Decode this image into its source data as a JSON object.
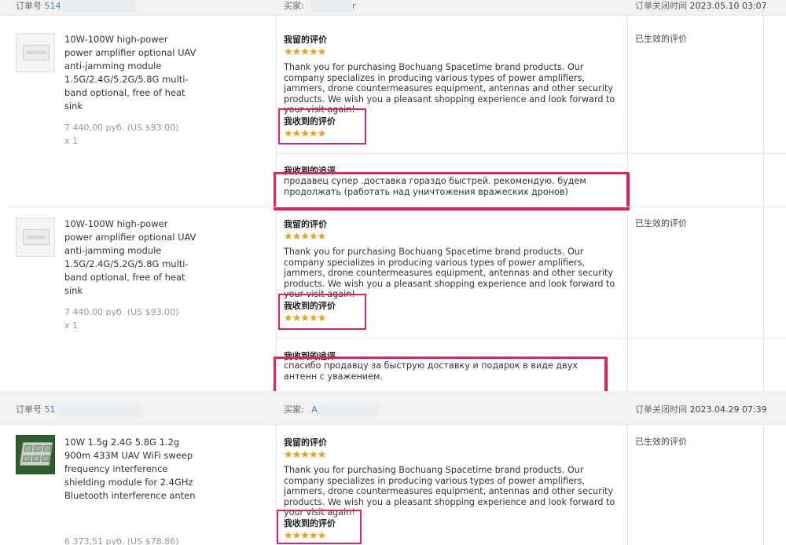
{
  "labels": {
    "order_no": "订单号",
    "buyer": "买家:",
    "close_time": "订单关闭时间",
    "my_review": "我留的评价",
    "received_review": "我收到的评价",
    "received_followup": "我收到的追评",
    "status_effective": "已生效的评价"
  },
  "rating_stars": "★★★★★",
  "orders": [
    {
      "order_no_visible": "514",
      "buyer_visible": "r",
      "close_time": "2023.05.10 03:07",
      "items": [
        {
          "name": "10W-100W high-power power amplifier optional UAV anti-jamming module 1.5G/2.4G/5.2G/5.8G multi-band optional, free of heat sink",
          "price": "7 440,00 руб. (US $93.00)",
          "qty": "x 1",
          "my_review_text": "Thank you for purchasing Bochuang Spacetime brand products. Our company specializes in producing various types of power amplifiers, jammers, drone countermeasures equipment, antennas and other security products. We wish you a pleasant shopping experience and look forward to your visit again!",
          "followup_text": "продавец супер .доставка гораздо быстрей. рекомендую. будем продолжать (работать над уничтожения вражеских дронов)"
        },
        {
          "name": "10W-100W high-power power amplifier optional UAV anti-jamming module 1.5G/2.4G/5.2G/5.8G multi-band optional, free of heat sink",
          "price": "7 440,00 руб. (US $93.00)",
          "qty": "x 1",
          "my_review_text": "Thank you for purchasing Bochuang Spacetime brand products. Our company specializes in producing various types of power amplifiers, jammers, drone countermeasures equipment, antennas and other security products. We wish you a pleasant shopping experience and look forward to your visit again!",
          "followup_text": "спасибо продавцу за быструю доставку и подарок в виде двух антенн с уважением."
        }
      ]
    },
    {
      "order_no_visible": "51",
      "buyer_visible": "A",
      "close_time": "2023.04.29 07:39",
      "items": [
        {
          "name": "10W 1.5g 2.4G 5.8G 1.2g 900m 433M UAV WiFi sweep frequency interference shielding module for 2.4GHz Bluetooth interference anten",
          "price": "6 373,51 руб. (US $78.86)",
          "my_review_text": "Thank you for purchasing Bochuang Spacetime brand products. Our company specializes in producing various types of power amplifiers, jammers, drone countermeasures equipment, antennas and other security products. We wish you a pleasant shopping experience and look forward to your visit again!"
        }
      ]
    }
  ]
}
